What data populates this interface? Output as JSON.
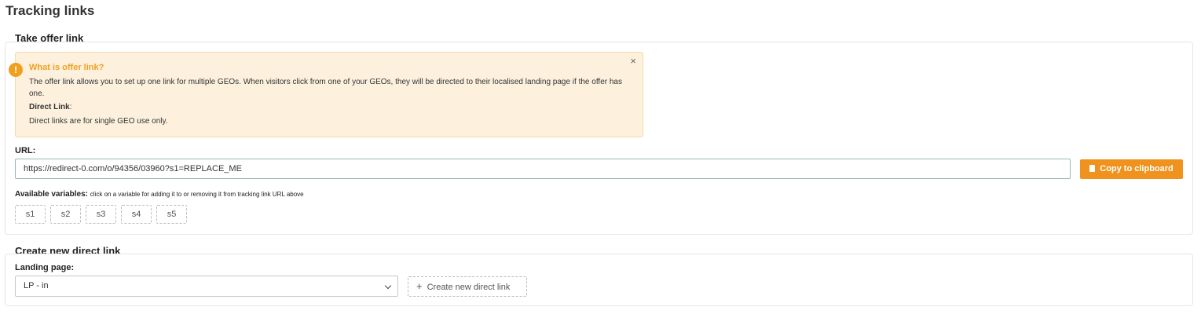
{
  "page": {
    "title": "Tracking links"
  },
  "offer_section": {
    "title": "Take offer link",
    "alert": {
      "icon": "info-icon",
      "title": "What is offer link?",
      "body": "The offer link allows you to set up one link for multiple GEOs. When visitors click from one of your GEOs, they will be directed to their localised landing page if the offer has one.",
      "direct_label": "Direct Link",
      "direct_colon": ":",
      "direct_body": "Direct links are for single GEO use only.",
      "close": "×"
    },
    "url_label": "URL:",
    "url_value": "https://redirect-0.com/o/94356/03960?s1=REPLACE_ME",
    "copy_label": "Copy to clipboard",
    "vars_label": "Available variables:",
    "vars_hint": "click on a variable for adding it to or removing it from tracking link URL above",
    "variables": [
      "s1",
      "s2",
      "s3",
      "s4",
      "s5"
    ]
  },
  "direct_section": {
    "title": "Create new direct link",
    "landing_label": "Landing page:",
    "landing_value": "LP - in",
    "create_label": "Create new direct link"
  },
  "colors": {
    "accent": "#f0921e",
    "alert_bg": "#fdf1de",
    "alert_title": "#f0a020"
  }
}
